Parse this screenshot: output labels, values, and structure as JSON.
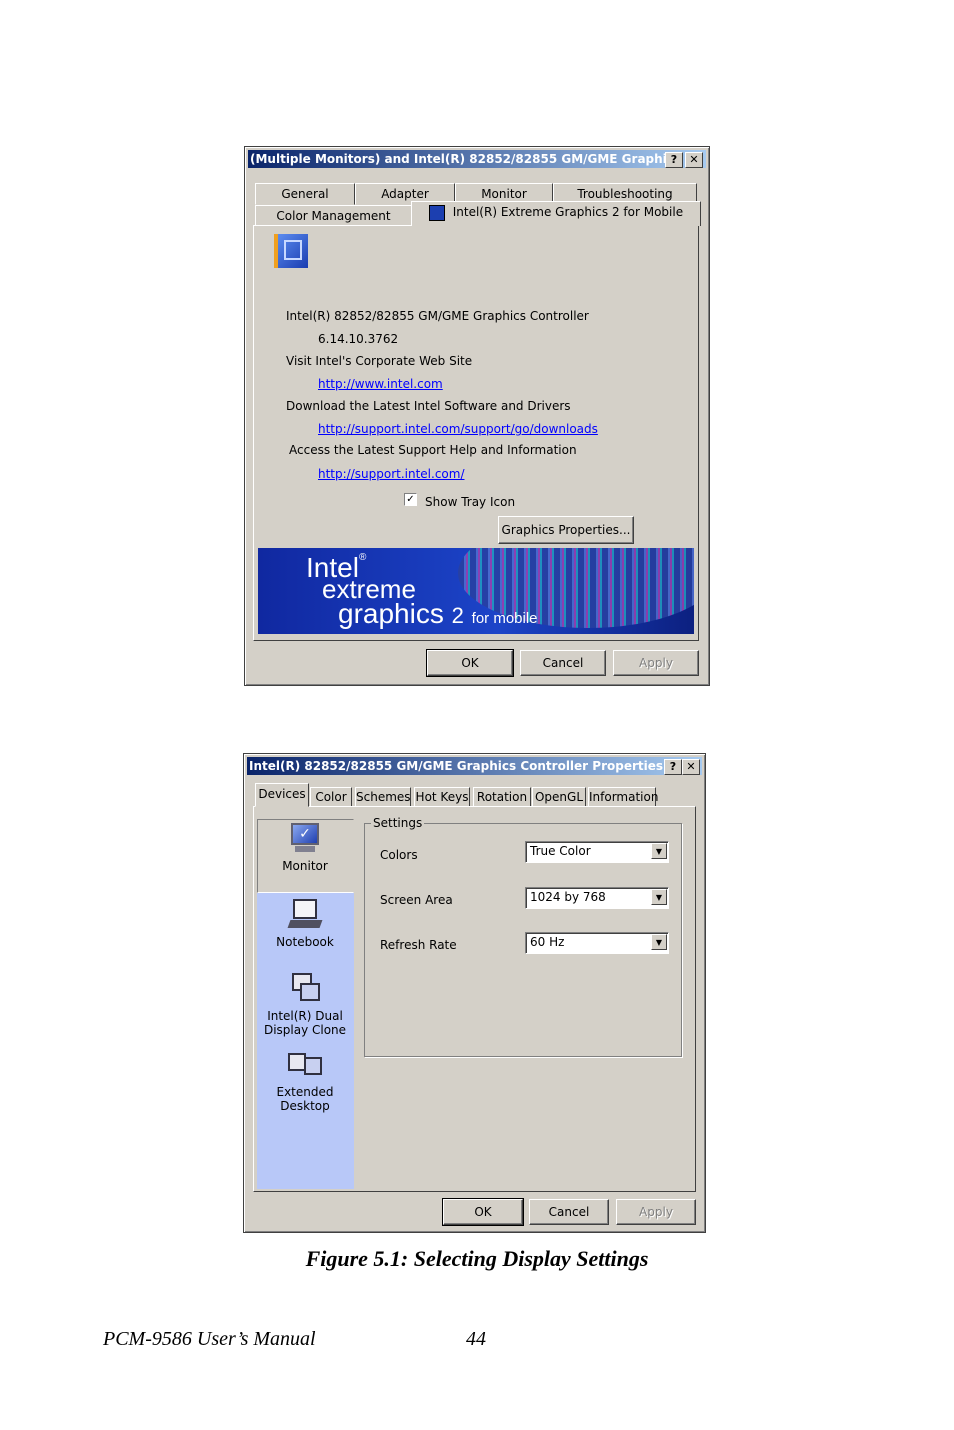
{
  "dialog1": {
    "title": "(Multiple Monitors) and Intel(R) 82852/82855 GM/GME Graphi...",
    "help_glyph": "?",
    "close_glyph": "✕",
    "tabs_row1": [
      "General",
      "Adapter",
      "Monitor",
      "Troubleshooting"
    ],
    "tabs_row2": [
      "Color Management",
      "Intel(R) Extreme Graphics 2 for Mobile"
    ],
    "controller_name": "Intel(R) 82852/82855 GM/GME Graphics Controller",
    "driver_version": "6.14.10.3762",
    "visit_label": "Visit Intel's Corporate Web Site",
    "visit_url": "http://www.intel.com",
    "download_label": "Download the Latest Intel Software and Drivers",
    "download_url": "http://support.intel.com/support/go/downloads",
    "support_label": "Access the Latest Support Help and Information",
    "support_url": "http://support.intel.com/",
    "tray_checkbox_label": "Show Tray Icon",
    "tray_checked": true,
    "graphics_properties_button": "Graphics Properties...",
    "banner": {
      "brand": "Intel",
      "line1": "extreme",
      "line2": "graphics",
      "version": "2",
      "suffix": "for mobile"
    },
    "ok": "OK",
    "cancel": "Cancel",
    "apply": "Apply"
  },
  "dialog2": {
    "title": "Intel(R) 82852/82855 GM/GME Graphics Controller Properties",
    "help_glyph": "?",
    "close_glyph": "✕",
    "tabs": [
      "Devices",
      "Color",
      "Schemes",
      "Hot Keys",
      "Rotation",
      "OpenGL",
      "Information"
    ],
    "devices": [
      {
        "label_line1": "Monitor",
        "label_line2": "",
        "icon": "monitor-icon"
      },
      {
        "label_line1": "Notebook",
        "label_line2": "",
        "icon": "notebook-icon"
      },
      {
        "label_line1": "Intel(R) Dual",
        "label_line2": "Display Clone",
        "icon": "dual-display-clone-icon"
      },
      {
        "label_line1": "Extended Desktop",
        "label_line2": "",
        "icon": "extended-desktop-icon"
      }
    ],
    "settings_group": "Settings",
    "settings": [
      {
        "label": "Colors",
        "value": "True Color"
      },
      {
        "label": "Screen Area",
        "value": "1024 by 768"
      },
      {
        "label": "Refresh Rate",
        "value": "60 Hz"
      }
    ],
    "ok": "OK",
    "cancel": "Cancel",
    "apply": "Apply"
  },
  "caption": "Figure 5.1: Selecting Display Settings",
  "footer": {
    "manual": "PCM-9586 User’s Manual",
    "page": "44"
  }
}
